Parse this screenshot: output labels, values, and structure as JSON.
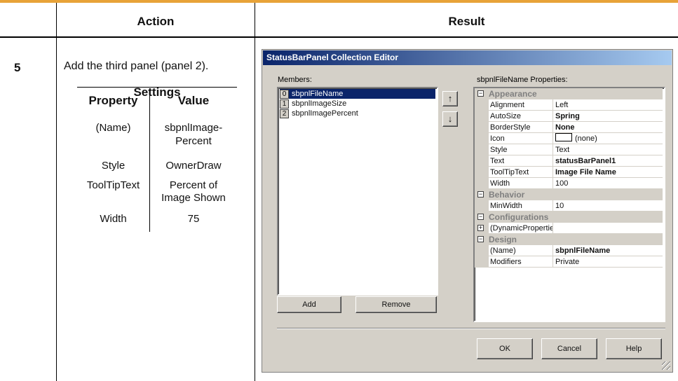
{
  "table": {
    "col_action": "Action",
    "col_result": "Result",
    "step_number": "5",
    "action_text": "Add the third panel (panel 2)."
  },
  "settings": {
    "title": "Settings",
    "headers": [
      "Property",
      "Value"
    ],
    "rows": [
      {
        "property": "(Name)",
        "value_line1": "sbpnlImage-",
        "value_line2": "Percent"
      },
      {
        "property": "Style",
        "value_line1": "OwnerDraw",
        "value_line2": ""
      },
      {
        "property": "ToolTipText",
        "value_line1": "Percent of",
        "value_line2": "Image Shown"
      },
      {
        "property": "Width",
        "value_line1": "75",
        "value_line2": ""
      }
    ]
  },
  "dialog": {
    "title": "StatusBarPanel Collection Editor",
    "members_label": "Members:",
    "members": [
      {
        "index": "0",
        "name": "sbpnlFileName",
        "selected": true
      },
      {
        "index": "1",
        "name": "sbpnlImageSize",
        "selected": false
      },
      {
        "index": "2",
        "name": "sbpnlImagePercent",
        "selected": false
      }
    ],
    "up_arrow": "↑",
    "down_arrow": "↓",
    "add_label": "Add",
    "remove_label": "Remove",
    "properties_label": "sbpnlFileName Properties:",
    "categories": {
      "appearance": "Appearance",
      "behavior": "Behavior",
      "configurations": "Configurations",
      "design": "Design"
    },
    "properties": {
      "alignment": {
        "name": "Alignment",
        "value": "Left"
      },
      "autosize": {
        "name": "AutoSize",
        "value": "Spring"
      },
      "borderstyle": {
        "name": "BorderStyle",
        "value": "None"
      },
      "icon": {
        "name": "Icon",
        "value": "(none)"
      },
      "style": {
        "name": "Style",
        "value": "Text"
      },
      "text": {
        "name": "Text",
        "value": "statusBarPanel1"
      },
      "tooltiptext": {
        "name": "ToolTipText",
        "value": "Image File Name"
      },
      "width": {
        "name": "Width",
        "value": "100"
      },
      "minwidth": {
        "name": "MinWidth",
        "value": "10"
      },
      "dynamic": {
        "name": "(DynamicPropertie",
        "value": ""
      },
      "name": {
        "name": "(Name)",
        "value": "sbpnlFileName"
      },
      "modifiers": {
        "name": "Modifiers",
        "value": "Private"
      }
    },
    "ok_label": "OK",
    "cancel_label": "Cancel",
    "help_label": "Help"
  },
  "colors": {
    "accent_bar": "#e8a338",
    "title_bar": "#0a246a",
    "dialog_face": "#d4d0c8"
  }
}
